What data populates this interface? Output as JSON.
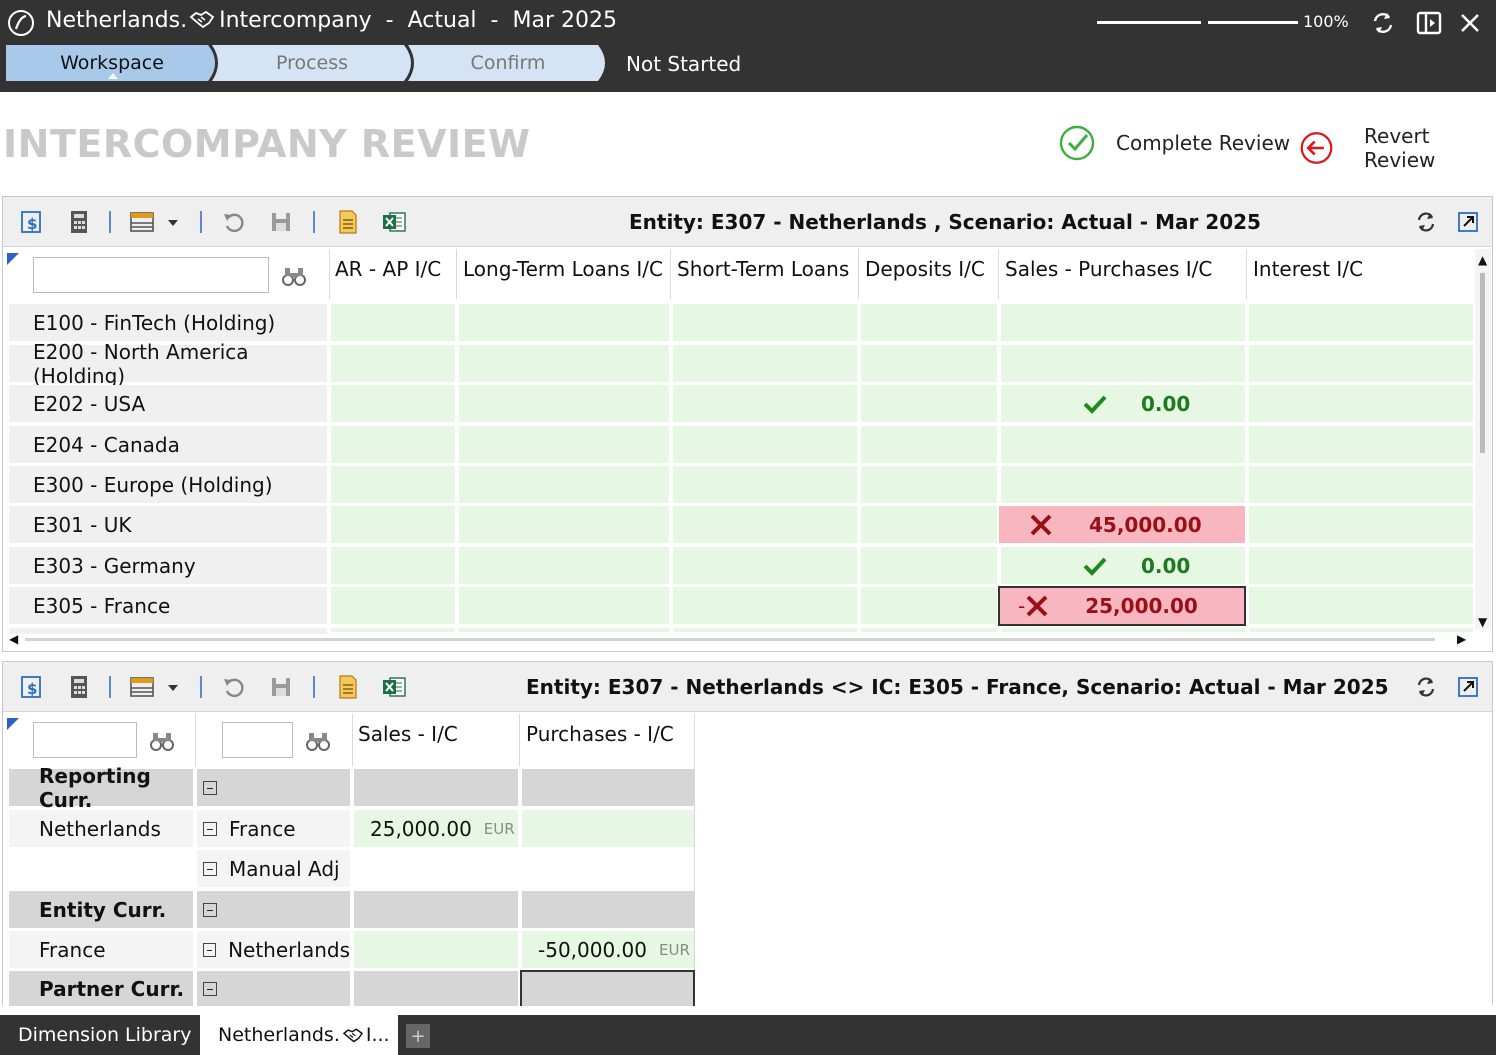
{
  "titlebar": {
    "entity": "Netherlands.",
    "module": "Intercompany",
    "scenario": "Actual",
    "period": "Mar 2025",
    "separator": "-",
    "zoom": "100%"
  },
  "workflow": {
    "steps": [
      "Workspace",
      "Process",
      "Confirm"
    ],
    "active_step": "Workspace",
    "status": "Not Started"
  },
  "page": {
    "title": "INTERCOMPANY REVIEW",
    "complete_label": "Complete Review",
    "revert_label": "Revert Review"
  },
  "grid1": {
    "title": "Entity:  E307 - Netherlands , Scenario: Actual - Mar 2025",
    "columns": [
      "AR - AP I/C",
      "Long-Term Loans I/C",
      "Short-Term Loans",
      "Deposits I/C",
      "Sales - Purchases I/C",
      "Interest I/C"
    ],
    "rows": [
      "E100 - FinTech (Holding)",
      "E200 - North America (Holding)",
      "E202 - USA",
      "E204 - Canada",
      "E300 - Europe (Holding)",
      "E301 - UK",
      "E303 - Germany",
      "E305 - France"
    ],
    "values": {
      "usa": "0.00",
      "uk": "45,000.00",
      "germany": "0.00",
      "france": "25,000.00",
      "france_prefix": "-"
    }
  },
  "grid2": {
    "title": "Entity:  E307 - Netherlands <> IC:  E305 - France, Scenario:  Actual - Mar 2025",
    "columns": [
      "Sales - I/C",
      "Purchases - I/C"
    ],
    "rows": {
      "reporting": "Reporting Curr.",
      "netherlands": "Netherlands",
      "france_partner": "France",
      "manual_adj": "Manual Adj",
      "entity": "Entity Curr.",
      "france": "France",
      "netherlands_partner": "Netherlands",
      "partner": "Partner Curr."
    },
    "values": {
      "sales_france": "25,000.00",
      "purchases_netherlands": "-50,000.00",
      "currency": "EUR"
    }
  },
  "bottom_tabs": {
    "tab1": "Dimension Library",
    "tab2_prefix": "Netherlands.",
    "tab2_suffix": " I...",
    "plus": "+"
  },
  "colors": {
    "titlebar": "#333333",
    "active_step": "#a9c9ea",
    "inactive_step": "#d4e4f5",
    "ok_green": "#1d7a1d",
    "error_red": "#9b0f14",
    "error_bg": "#f8b6c0",
    "cell_green": "#e6f7e4"
  }
}
